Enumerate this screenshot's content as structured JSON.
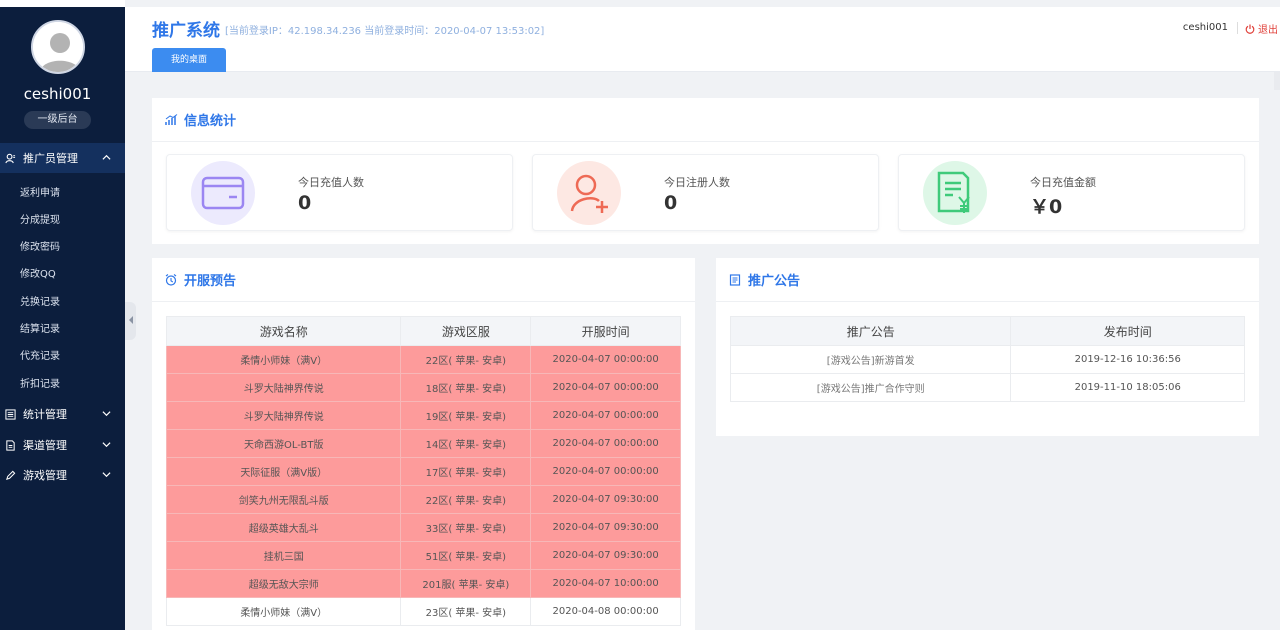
{
  "user": {
    "name": "ceshi001",
    "role": "一级后台"
  },
  "sidebar": {
    "groups": [
      {
        "label": "推广员管理",
        "icon": "user-icon",
        "expanded": true
      },
      {
        "label": "统计管理",
        "icon": "list-icon",
        "expanded": false
      },
      {
        "label": "渠道管理",
        "icon": "document-icon",
        "expanded": false
      },
      {
        "label": "游戏管理",
        "icon": "pencil-icon",
        "expanded": false
      }
    ],
    "sub_items": [
      "返利申请",
      "分成提现",
      "修改密码",
      "修改QQ",
      "兑换记录",
      "结算记录",
      "代充记录",
      "折扣记录"
    ]
  },
  "header": {
    "title": "推广系统",
    "login_info": "[当前登录IP：42.198.34.236 当前登录时间：2020-04-07 13:53:02]",
    "tab": "我的桌面",
    "user": "ceshi001",
    "logout": "退出"
  },
  "stats": {
    "title": "信息统计",
    "cards": [
      {
        "label": "今日充值人数",
        "value": "0",
        "icon": "card-icon",
        "color": "#8f7cf0"
      },
      {
        "label": "今日注册人数",
        "value": "0",
        "icon": "add-user-icon",
        "color": "#ee6a55"
      },
      {
        "label": "今日充值金额",
        "value": "￥0",
        "icon": "receipt-yen-icon",
        "color": "#3fca7a"
      }
    ]
  },
  "servers": {
    "title": "开服预告",
    "headers": [
      "游戏名称",
      "游戏区服",
      "开服时间"
    ],
    "rows": [
      {
        "name": "柔情小师妹（满V）",
        "server": "22区( 苹果- 安卓)",
        "time": "2020-04-07 00:00:00",
        "hot": true
      },
      {
        "name": "斗罗大陆神界传说",
        "server": "18区( 苹果- 安卓)",
        "time": "2020-04-07 00:00:00",
        "hot": true
      },
      {
        "name": "斗罗大陆神界传说",
        "server": "19区( 苹果- 安卓)",
        "time": "2020-04-07 00:00:00",
        "hot": true
      },
      {
        "name": "天命西游OL-BT版",
        "server": "14区( 苹果- 安卓)",
        "time": "2020-04-07 00:00:00",
        "hot": true
      },
      {
        "name": "天际征服（满V版）",
        "server": "17区( 苹果- 安卓)",
        "time": "2020-04-07 00:00:00",
        "hot": true
      },
      {
        "name": "剑笑九州无限乱斗版",
        "server": "22区( 苹果- 安卓)",
        "time": "2020-04-07 09:30:00",
        "hot": true
      },
      {
        "name": "超级英雄大乱斗",
        "server": "33区( 苹果- 安卓)",
        "time": "2020-04-07 09:30:00",
        "hot": true
      },
      {
        "name": "挂机三国",
        "server": "51区( 苹果- 安卓)",
        "time": "2020-04-07 09:30:00",
        "hot": true
      },
      {
        "name": "超级无敌大宗师",
        "server": "201服( 苹果- 安卓)",
        "time": "2020-04-07 10:00:00",
        "hot": true
      },
      {
        "name": "柔情小师妹（满V）",
        "server": "23区( 苹果- 安卓)",
        "time": "2020-04-08 00:00:00",
        "hot": false
      }
    ]
  },
  "notices": {
    "title": "推广公告",
    "headers": [
      "推广公告",
      "发布时间"
    ],
    "rows": [
      {
        "title": "[游戏公告]新游首发",
        "time": "2019-12-16 10:36:56"
      },
      {
        "title": "[游戏公告]推广合作守则",
        "time": "2019-11-10 18:05:06"
      }
    ]
  }
}
